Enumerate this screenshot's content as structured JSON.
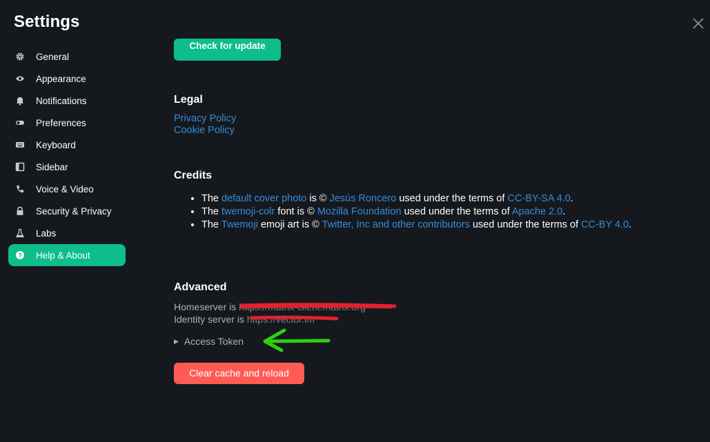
{
  "header": {
    "title": "Settings"
  },
  "sidebar": {
    "items": [
      {
        "label": "General",
        "icon": "gear-icon"
      },
      {
        "label": "Appearance",
        "icon": "eye-icon"
      },
      {
        "label": "Notifications",
        "icon": "bell-icon"
      },
      {
        "label": "Preferences",
        "icon": "toggle-icon"
      },
      {
        "label": "Keyboard",
        "icon": "keyboard-icon"
      },
      {
        "label": "Sidebar",
        "icon": "sidebar-icon"
      },
      {
        "label": "Voice & Video",
        "icon": "phone-icon"
      },
      {
        "label": "Security & Privacy",
        "icon": "lock-icon"
      },
      {
        "label": "Labs",
        "icon": "flask-icon"
      },
      {
        "label": "Help & About",
        "icon": "help-icon",
        "active": true
      }
    ]
  },
  "main": {
    "check_update_label": "Check for update",
    "legal": {
      "heading": "Legal",
      "links": [
        "Privacy Policy",
        "Cookie Policy"
      ]
    },
    "credits": {
      "heading": "Credits",
      "items": [
        {
          "t1": "The ",
          "l1": "default cover photo",
          "t2": " is © ",
          "l2": "Jesús Roncero",
          "t3": " used under the terms of ",
          "l3": "CC-BY-SA 4.0",
          "t4": "."
        },
        {
          "t1": "The ",
          "l1": "twemoji-colr",
          "t2": " font is © ",
          "l2": "Mozilla Foundation",
          "t3": " used under the terms of ",
          "l3": "Apache 2.0",
          "t4": "."
        },
        {
          "t1": "The ",
          "l1": "Twemoji",
          "t2": " emoji art is © ",
          "l2": "Twitter, Inc and other contributors",
          "t3": " used under the terms of ",
          "l3": "CC-BY 4.0",
          "t4": "."
        }
      ]
    },
    "advanced": {
      "heading": "Advanced",
      "homeserver_label": "Homeserver is ",
      "homeserver_value": "https://matrix-client.matrix.org",
      "identity_label": "Identity server is ",
      "identity_value": "https://vector.im",
      "access_token_label": "Access Token",
      "clear_cache_label": "Clear cache and reload"
    }
  },
  "colors": {
    "accent": "#0dbd8b",
    "danger": "#ff5b55",
    "link": "#368bd6",
    "background": "#15191e"
  }
}
